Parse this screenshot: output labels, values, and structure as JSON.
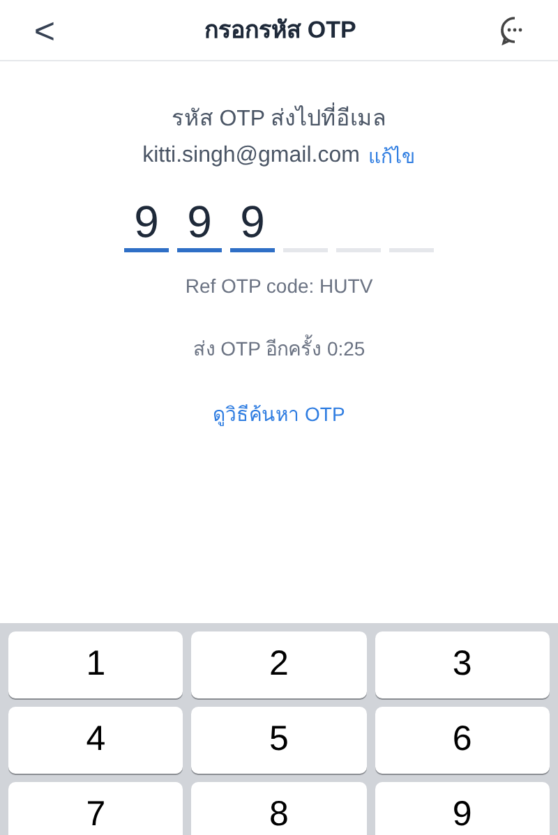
{
  "header": {
    "back": "<",
    "title": "กรอกรหัส OTP"
  },
  "message": "รหัส OTP ส่งไปที่อีเมล",
  "email": "kitti.singh@gmail.com",
  "edit_link": "แก้ไข",
  "otp_slots": [
    {
      "filled": true,
      "digit": "9"
    },
    {
      "filled": true,
      "digit": "9"
    },
    {
      "filled": true,
      "digit": "9"
    },
    {
      "filled": false
    },
    {
      "filled": false
    },
    {
      "filled": false
    }
  ],
  "ref_code": "Ref OTP code: HUTV",
  "resend": "ส่ง OTP อีกครั้ง 0:25",
  "help_link": "ดูวิธีค้นหา OTP",
  "keypad": [
    "1",
    "2",
    "3",
    "4",
    "5",
    "6",
    "7",
    "8",
    "9"
  ]
}
